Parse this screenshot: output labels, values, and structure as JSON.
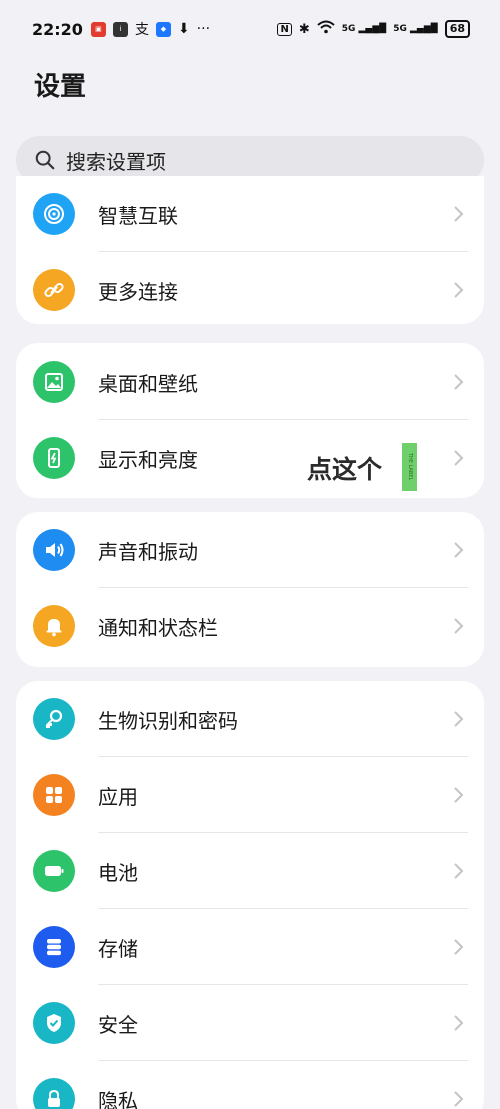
{
  "status_bar": {
    "time": "22:20",
    "left_icons": [
      "app-badge-icon",
      "info-badge-icon",
      "alipay-icon",
      "blue-app-icon",
      "download-icon",
      "more-dots-icon"
    ],
    "nfc": "N",
    "signal_1": "5G",
    "signal_2": "5G",
    "battery": "68"
  },
  "page": {
    "title": "设置"
  },
  "search": {
    "placeholder": "搜索设置项"
  },
  "groups": [
    {
      "items": [
        {
          "label": "智慧互联",
          "icon": "smart-connect-icon",
          "color": "#1fa3f5"
        },
        {
          "label": "更多连接",
          "icon": "link-icon",
          "color": "#f5a623"
        }
      ]
    },
    {
      "items": [
        {
          "label": "桌面和壁纸",
          "icon": "wallpaper-icon",
          "color": "#2cc36b"
        },
        {
          "label": "显示和亮度",
          "icon": "display-icon",
          "color": "#2cc36b"
        }
      ]
    },
    {
      "items": [
        {
          "label": "声音和振动",
          "icon": "sound-icon",
          "color": "#1e8cf0"
        },
        {
          "label": "通知和状态栏",
          "icon": "bell-icon",
          "color": "#f5a623"
        }
      ]
    },
    {
      "items": [
        {
          "label": "生物识别和密码",
          "icon": "key-icon",
          "color": "#19b7c6"
        },
        {
          "label": "应用",
          "icon": "apps-icon",
          "color": "#f58220"
        },
        {
          "label": "电池",
          "icon": "battery-icon",
          "color": "#2cc36b"
        },
        {
          "label": "存储",
          "icon": "storage-icon",
          "color": "#1e5cf0"
        },
        {
          "label": "安全",
          "icon": "shield-icon",
          "color": "#19b7c6"
        },
        {
          "label": "隐私",
          "icon": "privacy-lock-icon",
          "color": "#19b7c6"
        }
      ]
    }
  ],
  "annotation": {
    "text": "点这个",
    "tag": "THE LABEL"
  }
}
